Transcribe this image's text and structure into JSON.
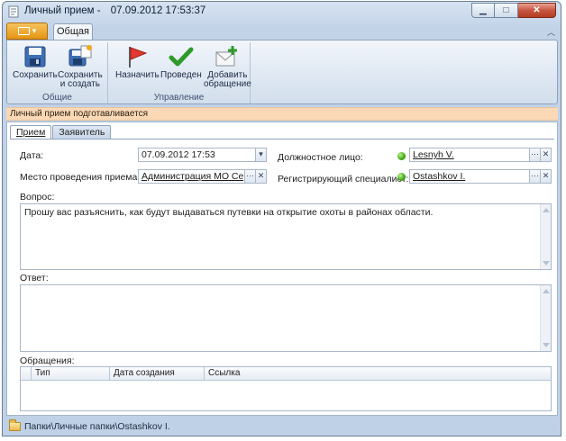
{
  "window": {
    "title": "Личный прием -",
    "datetime": "07.09.2012 17:53:37",
    "minimize_label": "▁",
    "maximize_label": "□",
    "close_label": "✕"
  },
  "ribbon": {
    "tab_label": "Общая",
    "groups": [
      {
        "title": "Общие",
        "buttons": [
          {
            "label": "Сохранить",
            "icon": "save-icon"
          },
          {
            "label": "Сохранить\nи создать",
            "icon": "save-and-create-icon"
          }
        ]
      },
      {
        "title": "Управление",
        "buttons": [
          {
            "label": "Назначить",
            "icon": "red-flag-icon"
          },
          {
            "label": "Проведен",
            "icon": "green-check-icon"
          },
          {
            "label": "Добавить\nобращение",
            "icon": "add-envelope-icon"
          }
        ]
      }
    ]
  },
  "status": "Личный прием подготавливается",
  "tabs": [
    "Прием",
    "Заявитель"
  ],
  "form": {
    "date_label": "Дата:",
    "date_value": "07.09.2012 17:53",
    "place_label": "Место проведения приема:",
    "place_value": "Администрация МО Сертолов",
    "official_label": "Должностное лицо:",
    "official_value": "Lesnyh V.",
    "registrar_label": "Регистрирующий специалист:",
    "registrar_value": "Ostashkov I.",
    "question_label": "Вопрос:",
    "question_text": "Прошу вас разъяснить, как будут выдаваться путевки на открытие охоты в районах области.",
    "answer_label": "Ответ:",
    "answer_text": "",
    "appeals_label": "Обращения:",
    "appeals_columns": [
      "Тип",
      "Дата создания",
      "Ссылка"
    ]
  },
  "footer": {
    "path": "Папки\\Личные папки\\Ostashkov I."
  }
}
